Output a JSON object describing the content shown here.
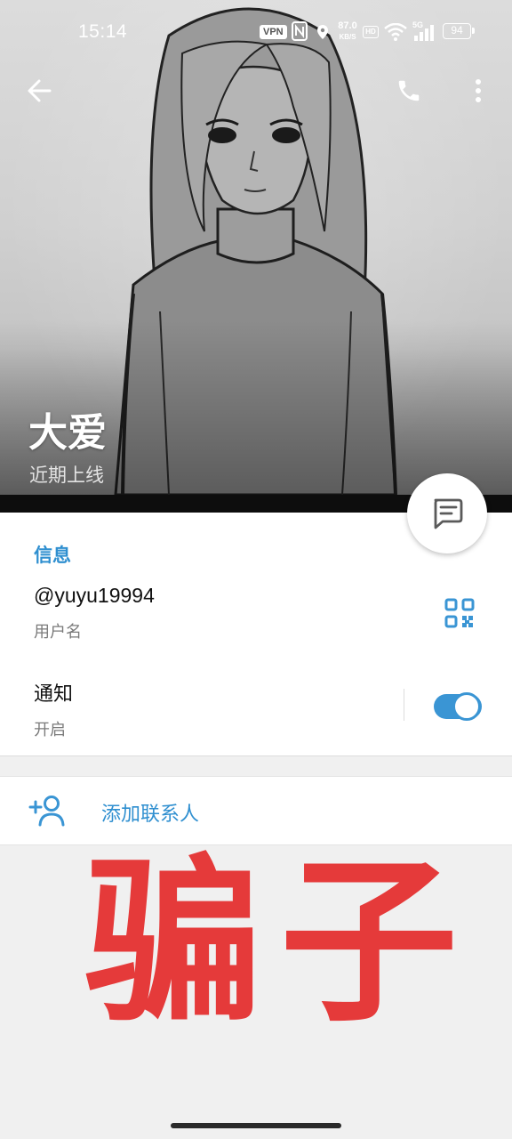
{
  "status_bar": {
    "time": "15:14",
    "vpn": "VPN",
    "net_speed": "87.0",
    "net_unit": "KB/S",
    "hd": "HD",
    "signal": "5G",
    "battery": "94"
  },
  "profile": {
    "name": "大爱",
    "status": "近期上线"
  },
  "info": {
    "section_title": "信息",
    "username": "@yuyu19994",
    "username_caption": "用户名",
    "notifications_label": "通知",
    "notifications_caption": "开启",
    "notifications_on": true
  },
  "actions": {
    "add_contact_label": "添加联系人"
  },
  "overlay_text": "骗子",
  "colors": {
    "accent": "#2f8fd0",
    "toggle": "#3a95d4",
    "overlay_red": "#e53a3a"
  },
  "icons": {
    "back": "arrow-left-icon",
    "call": "phone-icon",
    "more": "more-vertical-icon",
    "qr": "qr-code-icon",
    "message": "message-icon",
    "add_contact": "add-user-icon"
  }
}
